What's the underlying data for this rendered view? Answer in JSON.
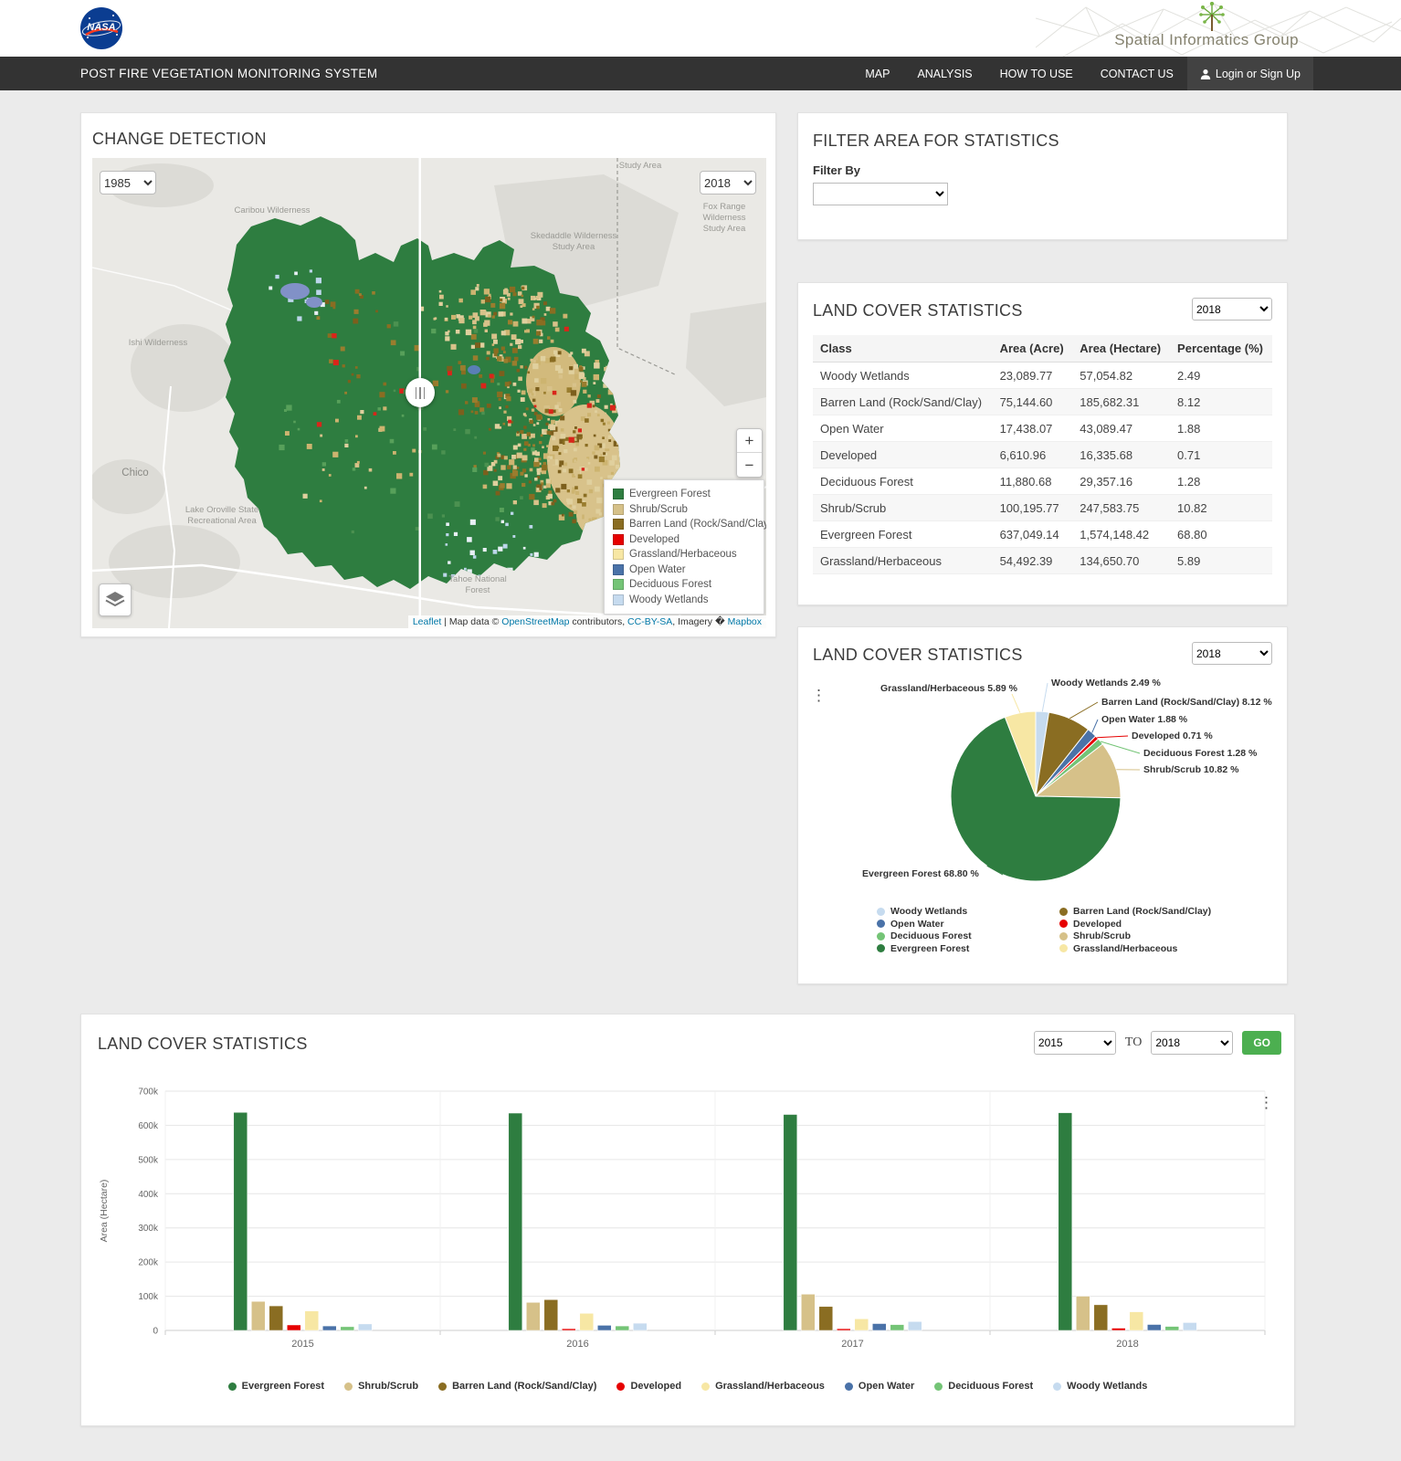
{
  "header": {
    "nasa_label": "NASA",
    "brand": "Spatial Informatics Group"
  },
  "nav": {
    "title": "POST FIRE VEGETATION MONITORING SYSTEM",
    "items": [
      {
        "label": "MAP"
      },
      {
        "label": "ANALYSIS"
      },
      {
        "label": "HOW TO USE"
      },
      {
        "label": "CONTACT US"
      }
    ],
    "login_label": "Login or Sign Up"
  },
  "change_detection": {
    "title": "CHANGE DETECTION",
    "left_year": "1985",
    "right_year": "2018",
    "map_labels": [
      "Caribou Wilderness",
      "Ishi Wilderness",
      "Skedaddle Wilderness\nStudy Area",
      "Fox Range Wilderness\nStudy Area",
      "Study Area",
      "Chico",
      "Lake Oroville State\nRecreational Area",
      "Tahoe National\nForest"
    ],
    "legend": [
      {
        "label": "Evergreen Forest",
        "color": "#2e7d40"
      },
      {
        "label": "Shrub/Scrub",
        "color": "#d6c189"
      },
      {
        "label": "Barren Land (Rock/Sand/Clay)",
        "color": "#8a6d22"
      },
      {
        "label": "Developed",
        "color": "#e60000"
      },
      {
        "label": "Grassland/Herbaceous",
        "color": "#f7e7a4"
      },
      {
        "label": "Open Water",
        "color": "#4a72a8"
      },
      {
        "label": "Deciduous Forest",
        "color": "#74c476"
      },
      {
        "label": "Woody Wetlands",
        "color": "#c6dbef"
      }
    ],
    "attribution": [
      {
        "text": "Leaflet",
        "link": true
      },
      {
        "text": " | Map data © ",
        "link": false
      },
      {
        "text": "OpenStreetMap",
        "link": true
      },
      {
        "text": " contributors, ",
        "link": false
      },
      {
        "text": "CC-BY-SA",
        "link": true
      },
      {
        "text": ", Imagery � ",
        "link": false
      },
      {
        "text": "Mapbox",
        "link": true
      }
    ]
  },
  "filter_card": {
    "title": "FILTER AREA FOR STATISTICS",
    "label": "Filter By"
  },
  "stats_card": {
    "title": "LAND COVER STATISTICS",
    "year": "2018",
    "columns": [
      "Class",
      "Area (Acre)",
      "Area (Hectare)",
      "Percentage (%)"
    ],
    "rows": [
      [
        "Woody Wetlands",
        "23,089.77",
        "57,054.82",
        "2.49"
      ],
      [
        "Barren Land (Rock/Sand/Clay)",
        "75,144.60",
        "185,682.31",
        "8.12"
      ],
      [
        "Open Water",
        "17,438.07",
        "43,089.47",
        "1.88"
      ],
      [
        "Developed",
        "6,610.96",
        "16,335.68",
        "0.71"
      ],
      [
        "Deciduous Forest",
        "11,880.68",
        "29,357.16",
        "1.28"
      ],
      [
        "Shrub/Scrub",
        "100,195.77",
        "247,583.75",
        "10.82"
      ],
      [
        "Evergreen Forest",
        "637,049.14",
        "1,574,148.42",
        "68.80"
      ],
      [
        "Grassland/Herbaceous",
        "54,492.39",
        "134,650.70",
        "5.89"
      ]
    ]
  },
  "pie_card": {
    "title": "LAND COVER STATISTICS",
    "year": "2018"
  },
  "bar_card": {
    "title": "LAND COVER STATISTICS",
    "from_year": "2015",
    "to_label": "TO",
    "to_year": "2018",
    "go_label": "GO"
  },
  "chart_data": [
    {
      "type": "pie",
      "title": "LAND COVER STATISTICS",
      "year": "2018",
      "labels": [
        "Woody Wetlands",
        "Barren Land (Rock/Sand/Clay)",
        "Open Water",
        "Developed",
        "Deciduous Forest",
        "Shrub/Scrub",
        "Evergreen Forest",
        "Grassland/Herbaceous"
      ],
      "values": [
        2.49,
        8.12,
        1.88,
        0.71,
        1.28,
        10.82,
        68.8,
        5.89
      ],
      "pct_labels": [
        "2.49",
        "8.12",
        "1.88",
        "0.71",
        "1.28",
        "10.82",
        "68.80",
        "5.89"
      ],
      "unit": "%",
      "colors": [
        "#c6dbef",
        "#8a6d22",
        "#4a72a8",
        "#e60000",
        "#74c476",
        "#d6c189",
        "#2e7d40",
        "#f7e7a4"
      ]
    },
    {
      "type": "bar",
      "title": "LAND COVER STATISTICS",
      "categories": [
        "2015",
        "2016",
        "2017",
        "2018"
      ],
      "ylabel": "Area (Hectare)",
      "ylim": [
        0,
        700000
      ],
      "yticks": [
        "0",
        "100k",
        "200k",
        "300k",
        "400k",
        "500k",
        "600k",
        "700k"
      ],
      "legend_position": "bottom",
      "series": [
        {
          "name": "Evergreen Forest",
          "color": "#2e7d40",
          "values": [
            638000,
            636000,
            632000,
            637049
          ]
        },
        {
          "name": "Shrub/Scrub",
          "color": "#d6c189",
          "values": [
            85000,
            82000,
            106000,
            100196
          ]
        },
        {
          "name": "Barren Land (Rock/Sand/Clay)",
          "color": "#8a6d22",
          "values": [
            72000,
            90000,
            70000,
            75145
          ]
        },
        {
          "name": "Developed",
          "color": "#e60000",
          "values": [
            16000,
            5000,
            5000,
            6611
          ]
        },
        {
          "name": "Grassland/Herbaceous",
          "color": "#f7e7a4",
          "values": [
            57000,
            50000,
            34000,
            54492
          ]
        },
        {
          "name": "Open Water",
          "color": "#4a72a8",
          "values": [
            13000,
            15000,
            20000,
            17438
          ]
        },
        {
          "name": "Deciduous Forest",
          "color": "#74c476",
          "values": [
            11000,
            13000,
            17000,
            11881
          ]
        },
        {
          "name": "Woody Wetlands",
          "color": "#c6dbef",
          "values": [
            19000,
            21000,
            26000,
            23090
          ]
        }
      ]
    }
  ]
}
